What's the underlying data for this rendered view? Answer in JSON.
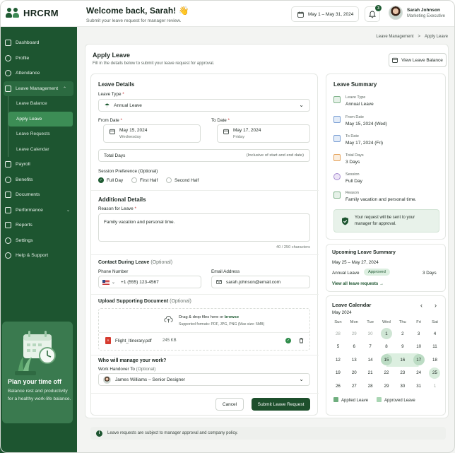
{
  "app": {
    "name": "HRCRM"
  },
  "header": {
    "welcome": "Welcome back, Sarah! 👋",
    "subtitle": "Submit your leave request for manager review.",
    "date_range": "May 1 – May 31, 2024",
    "notifications": "3",
    "user_name": "Sarah Johnson",
    "user_role": "Marketing Executive"
  },
  "sidebar": {
    "items": [
      {
        "label": "Dashboard",
        "icon": "grid-icon"
      },
      {
        "label": "Profile",
        "icon": "user-icon"
      },
      {
        "label": "Attendance",
        "icon": "clock-icon"
      },
      {
        "label": "Leave Management",
        "icon": "calendar-icon"
      },
      {
        "label": "Payroll",
        "icon": "wallet-icon"
      },
      {
        "label": "Benefits",
        "icon": "heart-icon"
      },
      {
        "label": "Documents",
        "icon": "document-icon"
      },
      {
        "label": "Performance",
        "icon": "chart-icon"
      },
      {
        "label": "Reports",
        "icon": "report-icon"
      },
      {
        "label": "Settings",
        "icon": "gear-icon"
      },
      {
        "label": "Help & Support",
        "icon": "help-icon"
      }
    ],
    "sub_items": [
      "Leave Balance",
      "Apply Leave",
      "Leave Requests",
      "Leave Calendar"
    ],
    "promo": {
      "title": "Plan your time off",
      "text": "Balance rest and productivity for a healthy work-life balance."
    }
  },
  "breadcrumb": {
    "parent": "Leave Management",
    "sep": ">",
    "current": "Apply Leave"
  },
  "page": {
    "title": "Apply Leave",
    "subtitle": "Fill in the details below to submit your leave request for approval.",
    "view_balance": "View Leave Balance"
  },
  "form": {
    "details_title": "Leave Details",
    "leave_type_label": "Leave Type",
    "leave_type_value": "Annual Leave",
    "from_label": "From Date",
    "from_date": "May 15, 2024",
    "from_day": "Wednesday",
    "to_label": "To Date",
    "to_date": "May 17, 2024",
    "to_day": "Friday",
    "total_days_label": "Total Days",
    "total_days_hint": "(Inclusive of start and end date)",
    "session_label": "Session Preference (Optional)",
    "session_options": [
      "Full Day",
      "First Half",
      "Second Half"
    ],
    "additional_title": "Additional Details",
    "reason_label": "Reason for Leave",
    "reason_value": "Family vacation and personal time.",
    "char_count": "40 / 250 characters",
    "contact_title": "Contact During Leave",
    "optional": "(Optional)",
    "phone_label": "Phone Number",
    "phone_value": "+1 (555) 123-4567",
    "email_label": "Email Address",
    "email_value": "sarah.johnson@email.com",
    "upload_title": "Upload Supporting Document",
    "upload_drag": "Drag & drop files here or",
    "upload_browse": "browse",
    "upload_formats": "Supported formats: PDF, JPG, PNG (Max size: 5MB)",
    "file_name": "Flight_Itinerary.pdf",
    "file_size": "245 KB",
    "manage_title": "Who will manage your work?",
    "handover_label": "Work Handover To",
    "handover_value": "James Williams – Senior Designer",
    "cancel": "Cancel",
    "submit": "Submit Leave Request"
  },
  "summary": {
    "title": "Leave Summary",
    "rows": [
      {
        "k": "Leave Type",
        "v": "Annual Leave",
        "color": "#e6f1e8"
      },
      {
        "k": "From Date",
        "v": "May 15, 2024  (Wed)",
        "color": "#e3ecf8"
      },
      {
        "k": "To Date",
        "v": "May 17, 2024  (Fri)",
        "color": "#e3ecf8"
      },
      {
        "k": "Total Days",
        "v": "3 Days",
        "color": "#fbeede"
      },
      {
        "k": "Session",
        "v": "Full Day",
        "color": "#ede5f6"
      },
      {
        "k": "Reason",
        "v": "Family vacation and personal time.",
        "color": "#e6f1e8"
      }
    ],
    "notice": "Your request will be sent to your manager for approval."
  },
  "upcoming": {
    "title": "Upcoming Leave Summary",
    "range": "May 25 – May 27, 2024",
    "type": "Annual Leave",
    "status": "Approved",
    "days": "3 Days",
    "link": "View all leave requests"
  },
  "calendar": {
    "title": "Leave Calendar",
    "month": "May 2024",
    "weekdays": [
      "Sun",
      "Mon",
      "Tue",
      "Wed",
      "Thu",
      "Fri",
      "Sat"
    ],
    "weeks": [
      [
        "28",
        "29",
        "30",
        "1",
        "2",
        "3",
        "4"
      ],
      [
        "5",
        "6",
        "7",
        "8",
        "9",
        "10",
        "11"
      ],
      [
        "12",
        "13",
        "14",
        "15",
        "16",
        "17",
        "18"
      ],
      [
        "19",
        "20",
        "21",
        "22",
        "23",
        "24",
        "25"
      ],
      [
        "26",
        "27",
        "28",
        "29",
        "30",
        "31",
        "1"
      ]
    ],
    "legend_applied": "Applied Leave",
    "legend_approved": "Approved Leave"
  },
  "footer_note": "Leave requests are subject to manager approval and company policy."
}
